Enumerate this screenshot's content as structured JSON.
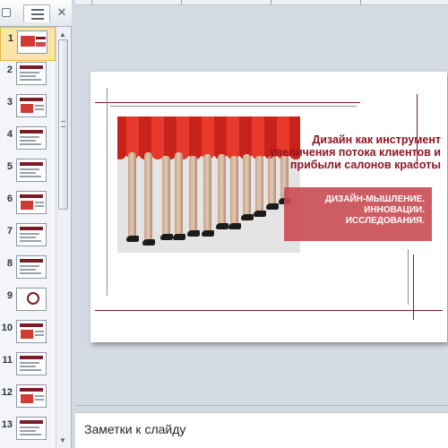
{
  "panel": {
    "close_label": "✕",
    "thumbnails": [
      {
        "number": "1",
        "active": true,
        "kind": "title"
      },
      {
        "number": "2",
        "kind": "text"
      },
      {
        "number": "3",
        "kind": "picture"
      },
      {
        "number": "4",
        "kind": "text"
      },
      {
        "number": "5",
        "kind": "text"
      },
      {
        "number": "6",
        "kind": "picture"
      },
      {
        "number": "7",
        "kind": "text"
      },
      {
        "number": "8",
        "kind": "text"
      },
      {
        "number": "9",
        "kind": "circle"
      },
      {
        "number": "10",
        "kind": "picture"
      },
      {
        "number": "11",
        "kind": "text"
      },
      {
        "number": "12",
        "kind": "picture"
      },
      {
        "number": "13",
        "kind": "text"
      }
    ]
  },
  "slide": {
    "title_lines": [
      "Дизайн как инструмент",
      "увеличения потока клиентов и",
      "прибыли салонов красоты"
    ],
    "box_lines": [
      "ДИЗАЙН-МЫШЛЕНИЕ.",
      "ИННОВАЦИИ.",
      "ИССЛЕДОВАНИЯ."
    ],
    "colors": {
      "accent": "#8e1522",
      "box": "#c94a52"
    }
  },
  "notes": {
    "placeholder": "Заметки к слайду"
  }
}
